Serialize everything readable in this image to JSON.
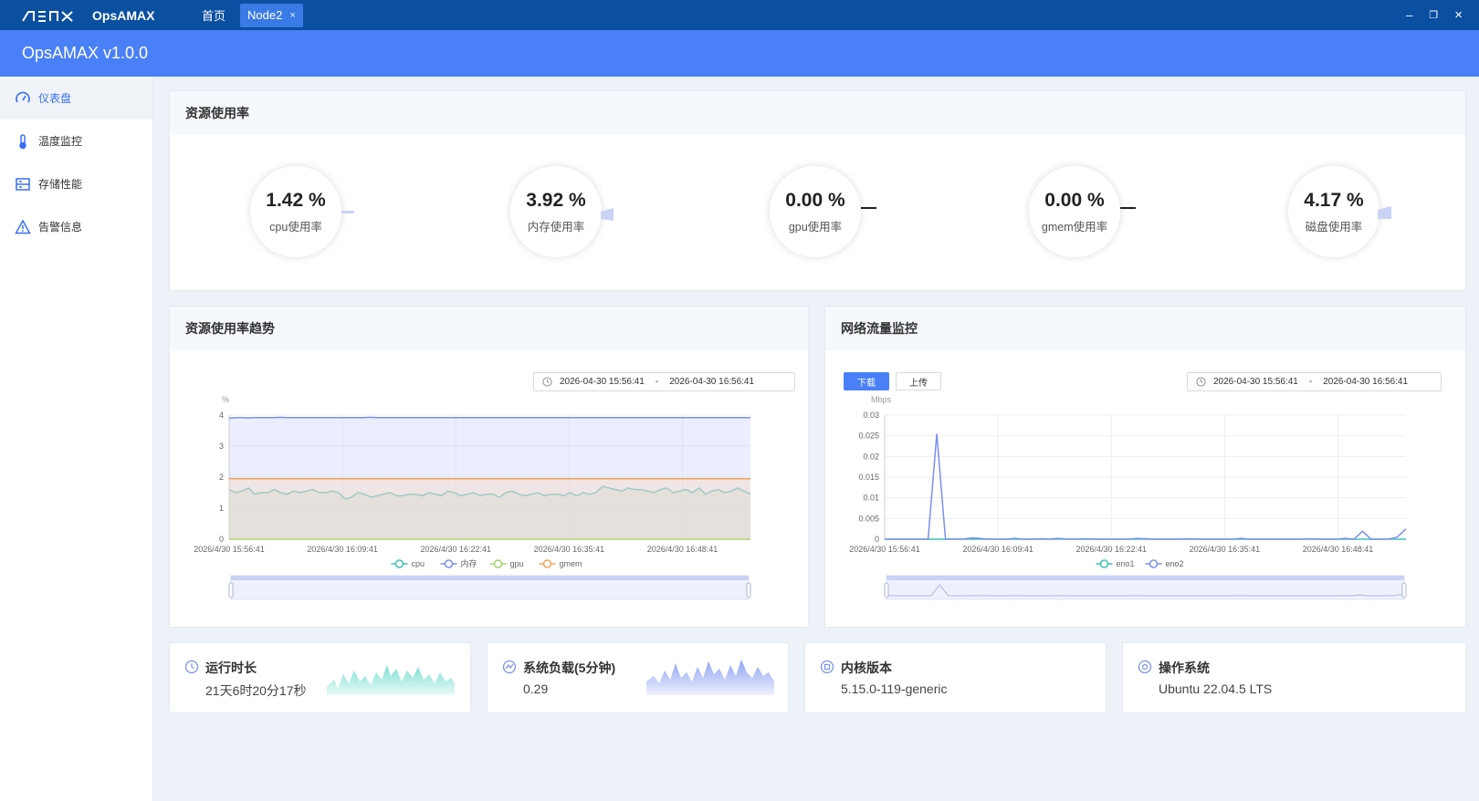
{
  "window": {
    "app_name": "OpsAMAX",
    "tabs": [
      {
        "label": "首页"
      },
      {
        "label": "Node2",
        "close": "×"
      }
    ],
    "controls": {
      "minimize": "–",
      "restore": "❐",
      "close": "×"
    }
  },
  "header": {
    "title": "OpsAMAX v1.0.0"
  },
  "sidebar": {
    "items": [
      {
        "label": "仪表盘",
        "icon": "dashboard-icon",
        "active": true
      },
      {
        "label": "温度监控",
        "icon": "thermometer-icon"
      },
      {
        "label": "存储性能",
        "icon": "storage-icon"
      },
      {
        "label": "告警信息",
        "icon": "warning-icon"
      }
    ]
  },
  "usage": {
    "title": "资源使用率",
    "gauges": [
      {
        "value": "1.42 %",
        "label": "cpu使用率",
        "percent": 1.42
      },
      {
        "value": "3.92 %",
        "label": "内存使用率",
        "percent": 3.92
      },
      {
        "value": "0.00 %",
        "label": "gpu使用率",
        "percent": 0
      },
      {
        "value": "0.00 %",
        "label": "gmem使用率",
        "percent": 0
      },
      {
        "value": "4.17 %",
        "label": "磁盘使用率",
        "percent": 4.17
      }
    ]
  },
  "trend": {
    "title": "资源使用率趋势",
    "range": {
      "start": "2026-04-30 15:56:41",
      "sep": "-",
      "end": "2026-04-30 16:56:41"
    }
  },
  "network": {
    "title": "网络流量监控",
    "buttons": {
      "download": "下载",
      "upload": "上传"
    },
    "range": {
      "start": "2026-04-30 15:56:41",
      "sep": "-",
      "end": "2026-04-30 16:56:41"
    }
  },
  "stats": [
    {
      "title": "运行时长",
      "value": "21天6时20分17秒"
    },
    {
      "title": "系统负载(5分钟)",
      "value": "0.29"
    },
    {
      "title": "内核版本",
      "value": "5.15.0-119-generic"
    },
    {
      "title": "操作系统",
      "value": "Ubuntu 22.04.5 LTS"
    }
  ],
  "colors": {
    "cpu": "#3fc1b5",
    "mem": "#7b8ff0",
    "gpu": "#9fd36a",
    "gmem": "#f3a25b",
    "eno1": "#3fc1b5",
    "eno2": "#7b8ff0",
    "accent": "#4a80f7"
  },
  "chart_data": [
    {
      "type": "area",
      "ylabel": "%",
      "ylim": [
        0,
        4
      ],
      "yticks": [
        0,
        1,
        2,
        3,
        4
      ],
      "xticks": [
        "2026/4/30 15:56:41",
        "2026/4/30 16:09:41",
        "2026/4/30 16:22:41",
        "2026/4/30 16:35:41",
        "2026/4/30 16:48:41"
      ],
      "legend": "bottom",
      "grid": true,
      "series": [
        {
          "name": "cpu",
          "values": [
            1.6,
            1.5,
            1.55,
            1.65,
            1.45,
            1.5,
            1.5,
            1.6,
            1.5,
            1.45,
            1.55,
            1.5,
            1.55,
            1.6,
            1.5,
            1.5,
            1.55,
            1.5,
            1.3,
            1.35,
            1.5,
            1.45,
            1.35,
            1.4,
            1.45,
            1.5,
            1.4,
            1.4,
            1.45,
            1.45,
            1.4,
            1.5,
            1.45,
            1.4,
            1.55,
            1.5,
            1.4,
            1.45,
            1.5,
            1.4,
            1.45,
            1.45,
            1.35,
            1.5,
            1.55,
            1.45,
            1.4,
            1.45,
            1.5,
            1.4,
            1.45,
            1.45,
            1.4,
            1.5,
            1.4,
            1.5,
            1.45,
            1.5,
            1.7,
            1.65,
            1.6,
            1.55,
            1.65,
            1.6,
            1.6,
            1.55,
            1.5,
            1.6,
            1.65,
            1.5,
            1.55,
            1.6,
            1.5,
            1.65,
            1.45,
            1.55,
            1.6,
            1.5,
            1.55,
            1.65,
            1.55,
            1.45
          ]
        },
        {
          "name": "内存",
          "values": [
            3.9,
            3.92,
            3.92,
            3.91,
            3.92,
            3.92,
            3.92,
            3.92,
            3.93,
            3.92,
            3.92,
            3.92,
            3.92,
            3.92,
            3.92,
            3.92,
            3.92,
            3.92,
            3.92,
            3.92,
            3.92,
            3.92,
            3.93,
            3.92,
            3.92,
            3.92,
            3.92,
            3.92,
            3.92,
            3.92,
            3.92,
            3.92,
            3.92,
            3.92,
            3.92,
            3.92,
            3.92,
            3.92,
            3.92,
            3.92,
            3.92,
            3.92,
            3.92,
            3.92,
            3.92,
            3.92,
            3.92,
            3.92,
            3.92,
            3.92,
            3.92,
            3.92,
            3.92,
            3.92,
            3.92,
            3.92,
            3.92,
            3.92,
            3.92,
            3.92,
            3.92,
            3.92,
            3.92,
            3.92,
            3.92,
            3.92,
            3.92,
            3.92,
            3.92,
            3.92,
            3.92,
            3.92,
            3.92,
            3.92,
            3.92,
            3.92,
            3.92,
            3.92,
            3.92,
            3.92,
            3.92,
            3.92
          ]
        },
        {
          "name": "gpu",
          "values": [
            0,
            0,
            0,
            0,
            0,
            0,
            0,
            0,
            0,
            0,
            0,
            0,
            0,
            0,
            0,
            0,
            0,
            0,
            0,
            0,
            0,
            0,
            0,
            0,
            0,
            0,
            0,
            0,
            0,
            0,
            0,
            0,
            0,
            0,
            0,
            0,
            0,
            0,
            0,
            0,
            0,
            0,
            0,
            0,
            0,
            0,
            0,
            0,
            0,
            0,
            0,
            0,
            0,
            0,
            0,
            0,
            0,
            0,
            0,
            0,
            0,
            0,
            0,
            0,
            0,
            0,
            0,
            0,
            0,
            0,
            0,
            0,
            0,
            0,
            0,
            0,
            0,
            0,
            0,
            0,
            0,
            0
          ]
        },
        {
          "name": "gmem",
          "values": [
            1.95,
            1.95,
            1.95,
            1.95,
            1.95,
            1.95,
            1.95,
            1.95,
            1.95,
            1.95,
            1.95,
            1.95,
            1.95,
            1.95,
            1.95,
            1.95,
            1.95,
            1.95,
            1.95,
            1.95,
            1.95,
            1.95,
            1.95,
            1.95,
            1.95,
            1.95,
            1.95,
            1.95,
            1.95,
            1.95,
            1.95,
            1.95,
            1.95,
            1.95,
            1.95,
            1.95,
            1.95,
            1.95,
            1.95,
            1.95,
            1.95,
            1.95,
            1.95,
            1.95,
            1.95,
            1.95,
            1.95,
            1.95,
            1.95,
            1.95,
            1.95,
            1.95,
            1.95,
            1.95,
            1.95,
            1.95,
            1.95,
            1.95,
            1.95,
            1.95,
            1.95,
            1.95,
            1.95,
            1.95,
            1.95,
            1.95,
            1.95,
            1.95,
            1.95,
            1.95,
            1.95,
            1.95,
            1.95,
            1.95,
            1.95,
            1.95,
            1.95,
            1.95,
            1.95,
            1.95,
            1.95,
            1.95
          ]
        }
      ]
    },
    {
      "type": "line",
      "ylabel": "Mbps",
      "ylim": [
        0,
        0.03
      ],
      "yticks": [
        "0",
        "0.005",
        "0.01",
        "0.015",
        "0.02",
        "0.025",
        "0.03"
      ],
      "xticks": [
        "2026/4/30 15:56:41",
        "2026/4/30 16:09:41",
        "2026/4/30 16:22:41",
        "2026/4/30 16:35:41",
        "2026/4/30 16:48:41"
      ],
      "legend": "bottom",
      "grid": true,
      "series": [
        {
          "name": "eno1",
          "values": [
            0,
            0,
            0,
            0,
            0,
            0,
            0,
            0,
            0,
            0,
            0,
            0,
            0,
            0,
            0,
            0,
            0,
            0,
            0,
            0,
            0,
            0,
            0,
            0,
            0,
            0,
            0,
            0,
            0,
            0,
            0,
            0,
            0,
            0,
            0,
            0,
            0,
            0,
            0,
            0,
            0,
            0,
            0,
            0,
            0,
            0,
            0,
            0,
            0,
            0,
            0,
            0,
            0,
            0,
            0,
            0,
            0,
            0,
            0,
            0,
            0
          ]
        },
        {
          "name": "eno2",
          "values": [
            0,
            0,
            0,
            0,
            0,
            0,
            0.0255,
            0,
            0,
            0,
            0.0003,
            0.0002,
            0,
            0,
            0,
            0.0002,
            0,
            0,
            0.0001,
            0,
            0.0002,
            0,
            0,
            0.0001,
            0,
            0,
            0,
            0,
            0,
            0.0002,
            0.0001,
            0,
            0,
            0,
            0,
            0.0001,
            0,
            0,
            0,
            0,
            0,
            0.0002,
            0,
            0,
            0,
            0,
            0,
            0,
            0,
            0.0001,
            0,
            0,
            0,
            0.0002,
            0,
            0.0019,
            0,
            0,
            0,
            0.0005,
            0.0025
          ]
        }
      ]
    }
  ]
}
